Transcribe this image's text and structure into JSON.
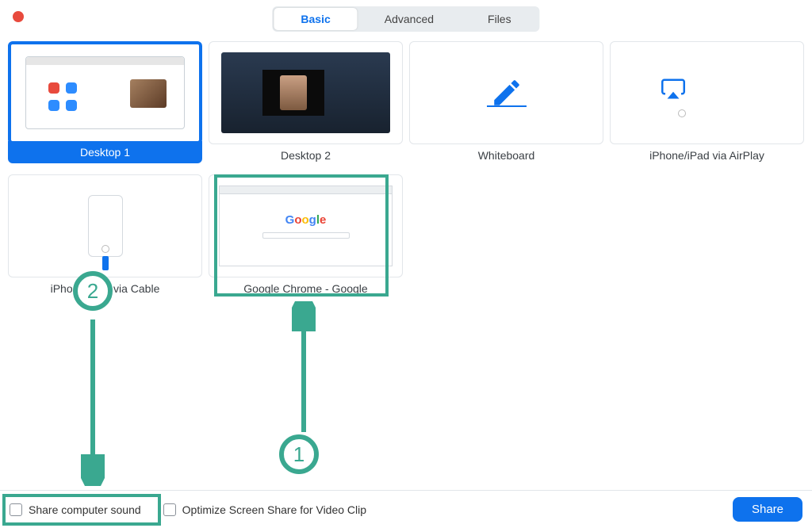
{
  "tabs": {
    "basic": "Basic",
    "advanced": "Advanced",
    "files": "Files"
  },
  "tiles": {
    "desktop1": "Desktop 1",
    "desktop2": "Desktop 2",
    "whiteboard": "Whiteboard",
    "airplay": "iPhone/iPad via AirPlay",
    "cable": "iPhone/iPad via Cable",
    "chrome": "Google Chrome - Google"
  },
  "footer": {
    "share_sound": "Share computer sound",
    "optimize": "Optimize Screen Share for Video Clip",
    "share_btn": "Share"
  },
  "annotations": {
    "step1": "1",
    "step2": "2"
  },
  "colors": {
    "accent": "#0e72ed",
    "annotation": "#3aa890"
  }
}
